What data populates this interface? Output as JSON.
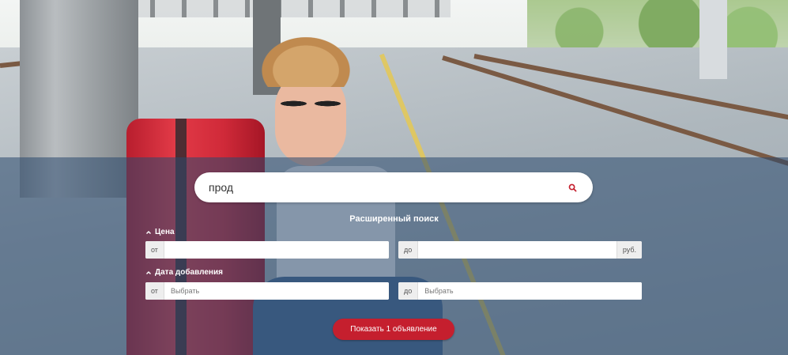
{
  "search": {
    "value": "прод",
    "icon": "search-icon"
  },
  "advanced": {
    "title": "Расширенный поиск"
  },
  "price": {
    "label": "Цена",
    "from_prefix": "от",
    "to_prefix": "до",
    "currency": "руб.",
    "from_value": "",
    "to_value": ""
  },
  "date_added": {
    "label": "Дата добавления",
    "from_prefix": "от",
    "to_prefix": "до",
    "from_placeholder": "Выбрать",
    "to_placeholder": "Выбрать"
  },
  "submit": {
    "label": "Показать 1 объявление"
  },
  "colors": {
    "overlay": "#2a486e",
    "button": "#c51f2e",
    "search_icon": "#c51f2e"
  }
}
